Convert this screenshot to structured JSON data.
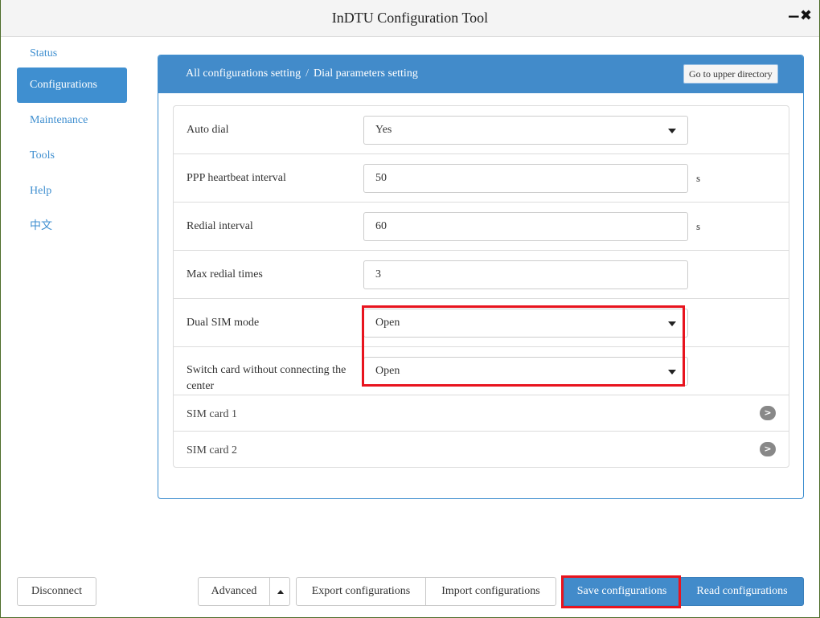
{
  "window": {
    "title": "InDTU Configuration Tool",
    "minimize_glyph": "−",
    "close_glyph": "✖"
  },
  "sidebar": {
    "items": [
      {
        "label": "Status",
        "active": false
      },
      {
        "label": "Configurations",
        "active": true
      },
      {
        "label": "Maintenance",
        "active": false
      },
      {
        "label": "Tools",
        "active": false
      },
      {
        "label": "Help",
        "active": false
      },
      {
        "label": "中文",
        "active": false
      }
    ]
  },
  "panel": {
    "breadcrumb": {
      "parent": "All configurations setting",
      "separator": "/",
      "current": "Dial parameters setting"
    },
    "up_button": "Go to upper directory",
    "rows": [
      {
        "label": "Auto dial",
        "value": "Yes",
        "type": "select",
        "unit": ""
      },
      {
        "label": "PPP heartbeat interval",
        "value": "50",
        "type": "input",
        "unit": "s"
      },
      {
        "label": "Redial interval",
        "value": "60",
        "type": "input",
        "unit": "s"
      },
      {
        "label": "Max redial times",
        "value": "3",
        "type": "input",
        "unit": ""
      },
      {
        "label": "Dual SIM mode",
        "value": "Open",
        "type": "select",
        "unit": ""
      },
      {
        "label": "Switch card without connecting the center",
        "value": "Open",
        "type": "select",
        "unit": ""
      }
    ],
    "sub_items": [
      {
        "label": "SIM card 1",
        "icon": "chevron-right-icon"
      },
      {
        "label": "SIM card 2",
        "icon": "chevron-right-icon"
      }
    ]
  },
  "footer": {
    "disconnect": "Disconnect",
    "advanced": "Advanced",
    "export": "Export configurations",
    "import": "Import configurations",
    "save": "Save configurations",
    "read": "Read configurations"
  },
  "colors": {
    "accent": "#428bca",
    "highlight": "#e8141e"
  }
}
